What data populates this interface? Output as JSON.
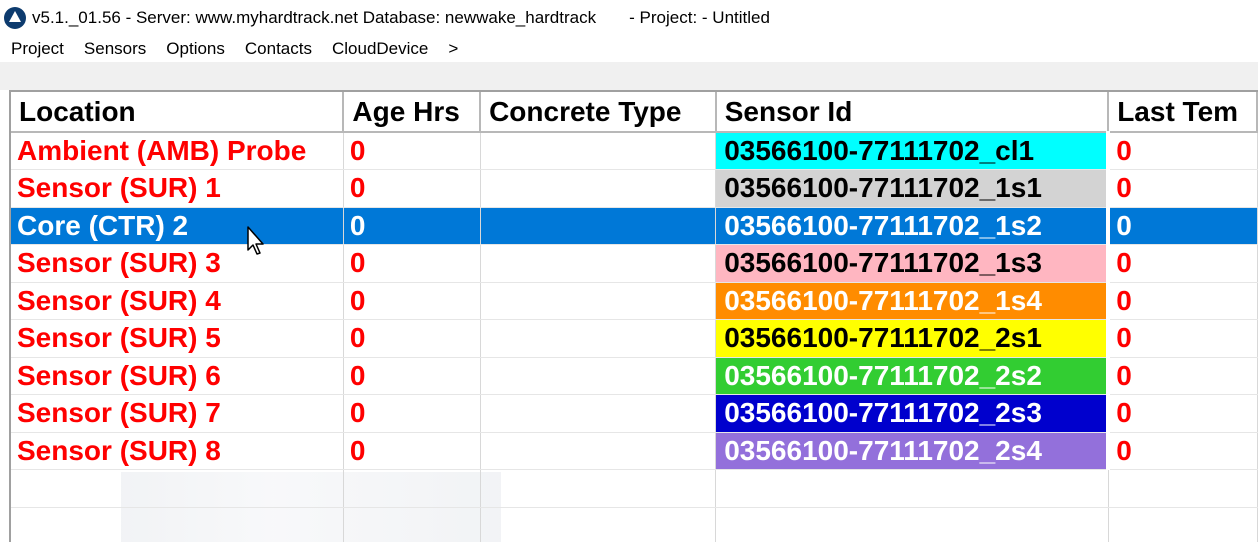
{
  "window": {
    "title": "v5.1._01.56 - Server: www.myhardtrack.net Database: newwake_hardtrack       - Project: - Untitled"
  },
  "menu": {
    "items": [
      "Project",
      "Sensors",
      "Options",
      "Contacts",
      "CloudDevice",
      ">"
    ]
  },
  "grid": {
    "columns": [
      "Location",
      "Age Hrs",
      "Concrete Type",
      "Sensor Id",
      "Last Tem"
    ],
    "rows": [
      {
        "location": "Ambient (AMB) Probe",
        "age": "0",
        "concrete": "",
        "sensor_id": "03566100-77111702_cl1",
        "last_temp": "0",
        "sensor_bg": "#00ffff",
        "sensor_fg": "#000000"
      },
      {
        "location": "Sensor (SUR) 1",
        "age": "0",
        "concrete": "",
        "sensor_id": "03566100-77111702_1s1",
        "last_temp": "0",
        "sensor_bg": "#d3d3d3",
        "sensor_fg": "#000000"
      },
      {
        "location": "Core (CTR) 2",
        "age": "0",
        "concrete": "",
        "sensor_id": "03566100-77111702_1s2",
        "last_temp": "0",
        "sensor_bg": "#0078d7",
        "sensor_fg": "#ffffff",
        "selected": true
      },
      {
        "location": "Sensor (SUR) 3",
        "age": "0",
        "concrete": "",
        "sensor_id": "03566100-77111702_1s3",
        "last_temp": "0",
        "sensor_bg": "#ffb6c1",
        "sensor_fg": "#000000"
      },
      {
        "location": "Sensor (SUR) 4",
        "age": "0",
        "concrete": "",
        "sensor_id": "03566100-77111702_1s4",
        "last_temp": "0",
        "sensor_bg": "#ff8c00",
        "sensor_fg": "#ffffff"
      },
      {
        "location": "Sensor (SUR) 5",
        "age": "0",
        "concrete": "",
        "sensor_id": "03566100-77111702_2s1",
        "last_temp": "0",
        "sensor_bg": "#ffff00",
        "sensor_fg": "#000000"
      },
      {
        "location": "Sensor (SUR) 6",
        "age": "0",
        "concrete": "",
        "sensor_id": "03566100-77111702_2s2",
        "last_temp": "0",
        "sensor_bg": "#32cd32",
        "sensor_fg": "#ffffff"
      },
      {
        "location": "Sensor (SUR) 7",
        "age": "0",
        "concrete": "",
        "sensor_id": "03566100-77111702_2s3",
        "last_temp": "0",
        "sensor_bg": "#0000cd",
        "sensor_fg": "#ffffff"
      },
      {
        "location": "Sensor (SUR) 8",
        "age": "0",
        "concrete": "",
        "sensor_id": "03566100-77111702_2s4",
        "last_temp": "0",
        "sensor_bg": "#9370db",
        "sensor_fg": "#ffffff"
      }
    ],
    "text_color": "#ff0000",
    "selection_color": "#0078d7"
  },
  "icons": {
    "app": "app-logo-icon",
    "cursor": "mouse-pointer-icon"
  }
}
